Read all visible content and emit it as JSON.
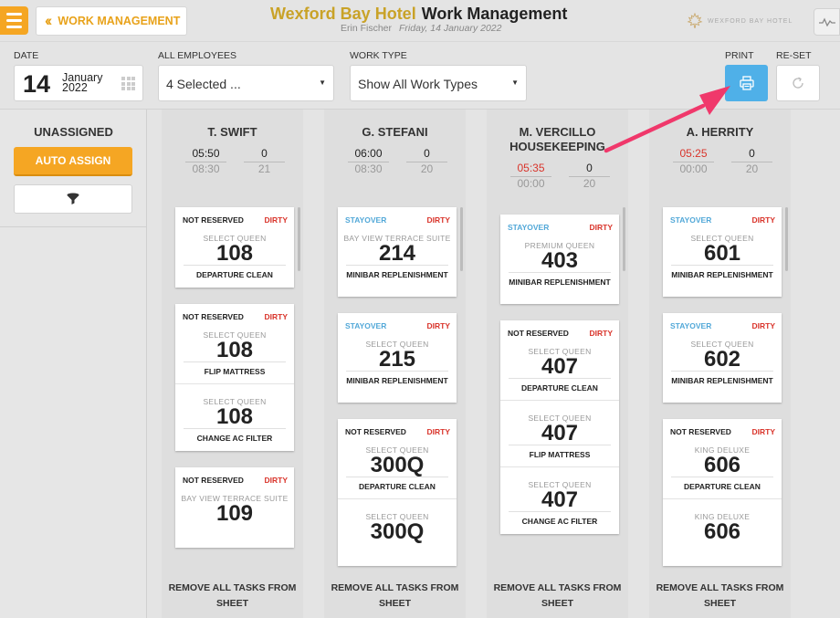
{
  "header": {
    "menu_icon": "hamburger-icon",
    "back_label": "WORK MANAGEMENT",
    "hotel_name": "Wexford Bay Hotel",
    "page_title": "Work Management",
    "user_name": "Erin Fischer",
    "current_date": "Friday, 14 January 2022",
    "logo_text": "WEXFORD BAY HOTEL",
    "accent_color": "#f5a623"
  },
  "filters": {
    "date_label": "DATE",
    "date_day": "14",
    "date_month": "January",
    "date_year": "2022",
    "employees_label": "ALL EMPLOYEES",
    "employees_value": "4 Selected ...",
    "worktype_label": "WORK TYPE",
    "worktype_value": "Show All Work Types",
    "print_label": "PRINT",
    "reset_label": "RE-SET"
  },
  "unassigned": {
    "title": "UNASSIGNED",
    "auto_assign_label": "AUTO ASSIGN",
    "filter_icon": "filter-icon"
  },
  "footer_label": "REMOVE ALL TASKS FROM SHEET",
  "columns": [
    {
      "name": "T. SWIFT",
      "time_top": "05:50",
      "time_sub": "08:30",
      "count_top": "0",
      "count_sub": "21",
      "time_late": false,
      "cards": [
        {
          "status": "NOT RESERVED",
          "cond": "DIRTY",
          "tasks": [
            {
              "room_type": "SELECT QUEEN",
              "room": "108",
              "task": "DEPARTURE CLEAN"
            }
          ]
        },
        {
          "status": "NOT RESERVED",
          "cond": "DIRTY",
          "tasks": [
            {
              "room_type": "SELECT QUEEN",
              "room": "108",
              "task": "FLIP MATTRESS"
            },
            {
              "room_type": "SELECT QUEEN",
              "room": "108",
              "task": "CHANGE AC FILTER"
            }
          ]
        },
        {
          "status": "NOT RESERVED",
          "cond": "DIRTY",
          "tasks": [
            {
              "room_type": "BAY VIEW TERRACE SUITE",
              "room": "109",
              "task": ""
            }
          ]
        }
      ]
    },
    {
      "name": "G. STEFANI",
      "time_top": "06:00",
      "time_sub": "08:30",
      "count_top": "0",
      "count_sub": "20",
      "time_late": false,
      "cards": [
        {
          "status": "STAYOVER",
          "cond": "DIRTY",
          "tasks": [
            {
              "room_type": "BAY VIEW TERRACE SUITE",
              "room": "214",
              "task": "MINIBAR REPLENISHMENT"
            }
          ]
        },
        {
          "status": "STAYOVER",
          "cond": "DIRTY",
          "tasks": [
            {
              "room_type": "SELECT QUEEN",
              "room": "215",
              "task": "MINIBAR REPLENISHMENT"
            }
          ]
        },
        {
          "status": "NOT RESERVED",
          "cond": "DIRTY",
          "tasks": [
            {
              "room_type": "SELECT QUEEN",
              "room": "300Q",
              "task": "DEPARTURE CLEAN"
            },
            {
              "room_type": "SELECT QUEEN",
              "room": "300Q",
              "task": ""
            }
          ]
        }
      ]
    },
    {
      "name": "M. VERCILLO HOUSEKEEPING",
      "time_top": "05:35",
      "time_sub": "00:00",
      "count_top": "0",
      "count_sub": "20",
      "time_late": true,
      "cards": [
        {
          "status": "STAYOVER",
          "cond": "DIRTY",
          "tasks": [
            {
              "room_type": "PREMIUM QUEEN",
              "room": "403",
              "task": "MINIBAR REPLENISHMENT"
            }
          ]
        },
        {
          "status": "NOT RESERVED",
          "cond": "DIRTY",
          "tasks": [
            {
              "room_type": "SELECT QUEEN",
              "room": "407",
              "task": "DEPARTURE CLEAN"
            },
            {
              "room_type": "SELECT QUEEN",
              "room": "407",
              "task": "FLIP MATTRESS"
            },
            {
              "room_type": "SELECT QUEEN",
              "room": "407",
              "task": "CHANGE AC FILTER"
            }
          ]
        }
      ]
    },
    {
      "name": "A. HERRITY",
      "time_top": "05:25",
      "time_sub": "00:00",
      "count_top": "0",
      "count_sub": "20",
      "time_late": true,
      "cards": [
        {
          "status": "STAYOVER",
          "cond": "DIRTY",
          "tasks": [
            {
              "room_type": "SELECT QUEEN",
              "room": "601",
              "task": "MINIBAR REPLENISHMENT"
            }
          ]
        },
        {
          "status": "STAYOVER",
          "cond": "DIRTY",
          "tasks": [
            {
              "room_type": "SELECT QUEEN",
              "room": "602",
              "task": "MINIBAR REPLENISHMENT"
            }
          ]
        },
        {
          "status": "NOT RESERVED",
          "cond": "DIRTY",
          "tasks": [
            {
              "room_type": "KING DELUXE",
              "room": "606",
              "task": "DEPARTURE CLEAN"
            },
            {
              "room_type": "KING DELUXE",
              "room": "606",
              "task": ""
            }
          ]
        }
      ]
    }
  ]
}
